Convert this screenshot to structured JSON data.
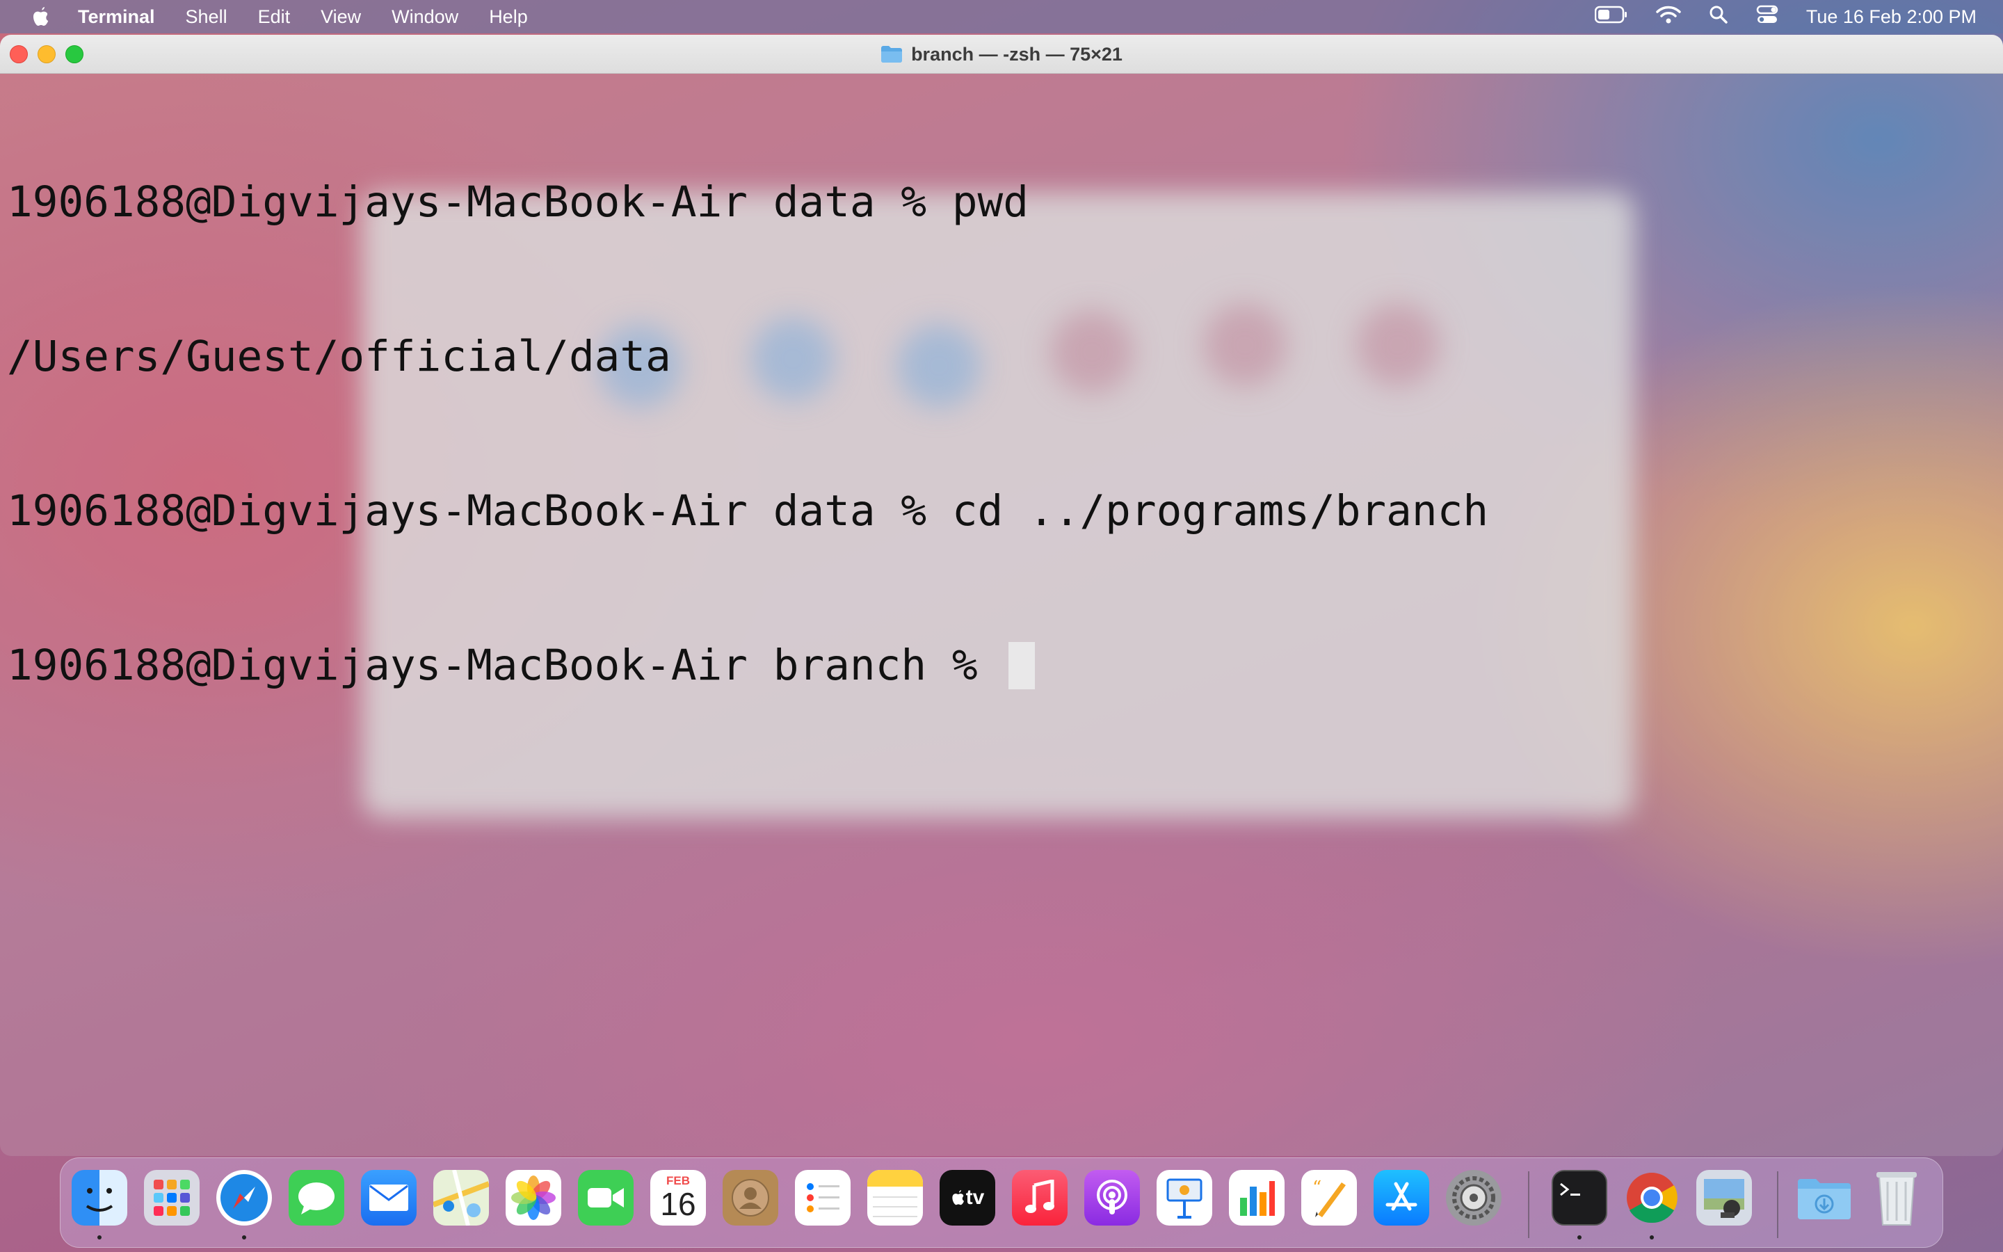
{
  "menubar": {
    "app_name": "Terminal",
    "items": [
      "Shell",
      "Edit",
      "View",
      "Window",
      "Help"
    ],
    "clock": "Tue 16 Feb  2:00 PM"
  },
  "window": {
    "title": "branch — -zsh — 75×21"
  },
  "terminal": {
    "lines": [
      "1906188@Digvijays-MacBook-Air data % pwd",
      "/Users/Guest/official/data",
      "1906188@Digvijays-MacBook-Air data % cd ../programs/branch",
      "1906188@Digvijays-MacBook-Air branch % "
    ]
  },
  "dock": {
    "calendar_month": "FEB",
    "calendar_day": "16",
    "tv_label": "tv",
    "apps": [
      "finder",
      "launchpad",
      "safari",
      "messages",
      "mail",
      "maps",
      "photos",
      "facetime",
      "calendar",
      "contacts",
      "reminders",
      "notes",
      "tv",
      "music",
      "podcasts",
      "keynote",
      "numbers",
      "pages",
      "app-store",
      "system-preferences",
      "terminal",
      "chrome",
      "preview",
      "downloads",
      "trash"
    ]
  }
}
